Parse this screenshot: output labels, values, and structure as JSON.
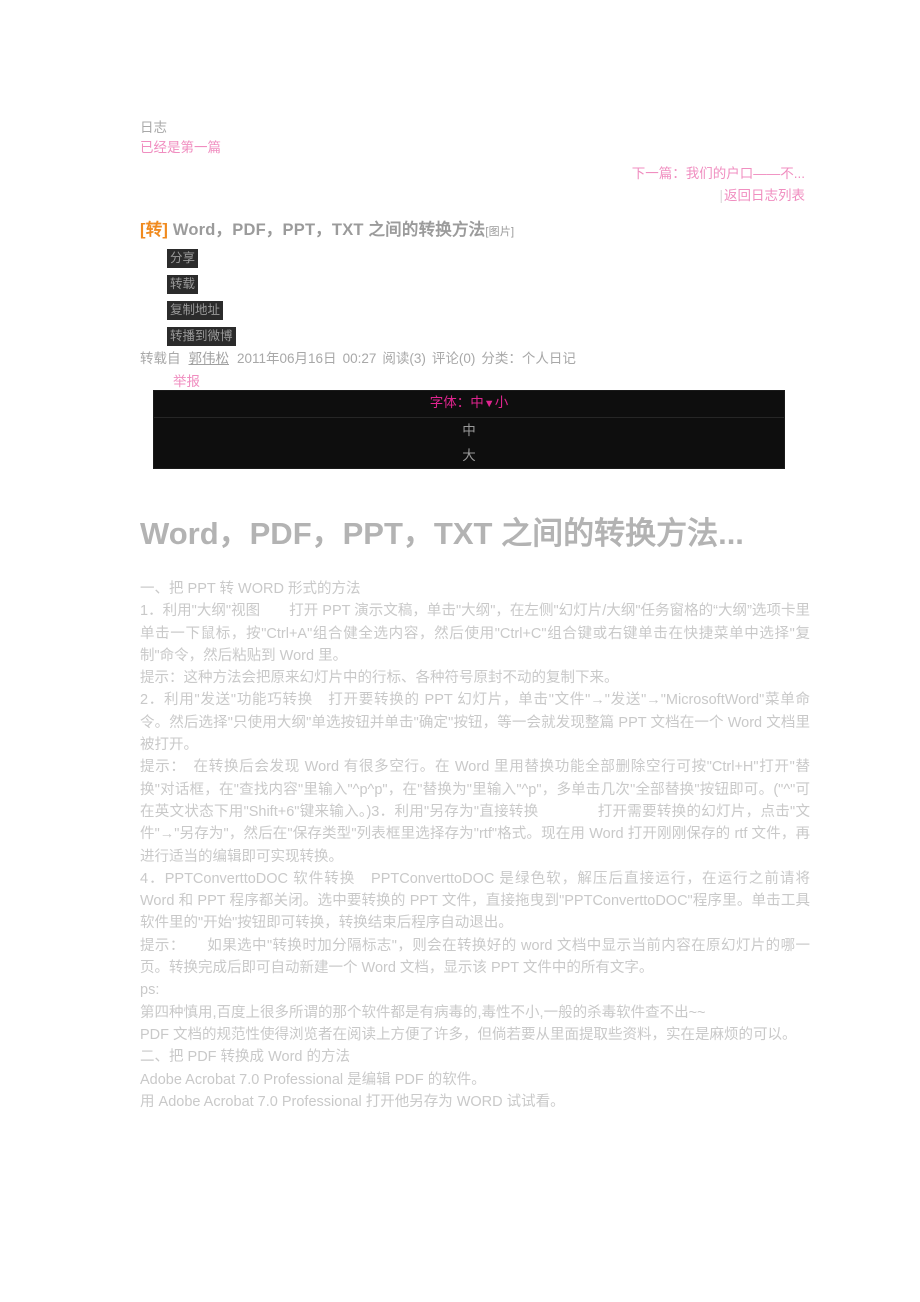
{
  "nav": {
    "section_label": "日志",
    "first_post_label": "已经是第一篇",
    "next_post": "下一篇：我们的户口——不...",
    "back_to_list": "返回日志列表",
    "separator": "|"
  },
  "post": {
    "repost_tag": "[转]",
    "title": "Word，PDF，PPT，TXT 之间的转换方法",
    "picture_tag": "[图片]"
  },
  "share": {
    "buttons": [
      {
        "label": "分享"
      },
      {
        "label": "转载"
      },
      {
        "label": "复制地址"
      },
      {
        "label": "转播到微博"
      }
    ]
  },
  "meta": {
    "source_label": "转载自",
    "author": "郭伟松",
    "date": "2011年06月16日",
    "time": "00:27",
    "reads": "阅读(3)",
    "comments": "评论(0)",
    "category": "分类：个人日记",
    "report_label": "举报"
  },
  "font_selector": {
    "label": "字体：",
    "current": "中",
    "caret": "▼",
    "small": "小",
    "options": [
      "中",
      "大"
    ]
  },
  "article": {
    "heading": "Word，PDF，PPT，TXT 之间的转换方法...",
    "paragraphs": [
      "一、把 PPT 转 WORD 形式的方法",
      "1．利用\"大纲\"视图　　打开 PPT 演示文稿，单击\"大纲\"，在左侧\"幻灯片/大纲\"任务窗格的“大纲”选项卡里单击一下鼠标，按\"Ctrl+A\"组合健全选内容，然后使用\"Ctrl+C\"组合键或右键单击在快捷菜单中选择\"复制\"命令，然后粘贴到 Word 里。",
      "提示：这种方法会把原来幻灯片中的行标、各种符号原封不动的复制下来。",
      "2．利用\"发送\"功能巧转换　打开要转换的 PPT 幻灯片，单击\"文件\"→\"发送\"→\"MicrosoftWord\"菜单命令。然后选择\"只使用大纲\"单选按钮并单击\"确定\"按钮，等一会就发现整篇 PPT 文档在一个 Word 文档里被打开。",
      "提示：　在转换后会发现 Word 有很多空行。在 Word 里用替换功能全部删除空行可按\"Ctrl+H\"打开\"替换\"对话框，在\"查找内容\"里输入\"^p^p\"，在\"替换为\"里输入\"^p\"，多单击几次\"全部替换\"按钮即可。(\"^\"可在英文状态下用\"Shift+6\"键来输入。)3．利用\"另存为\"直接转换　　　　打开需要转换的幻灯片，点击\"文件\"→\"另存为\"，然后在\"保存类型\"列表框里选择存为\"rtf\"格式。现在用 Word 打开刚刚保存的 rtf 文件，再进行适当的编辑即可实现转换。",
      "4．PPTConverttoDOC 软件转换　PPTConverttoDOC 是绿色软，解压后直接运行，在运行之前请将 Word 和 PPT 程序都关闭。选中要转换的 PPT 文件，直接拖曳到\"PPTConverttoDOC\"程序里。单击工具软件里的\"开始\"按钮即可转换，转换结束后程序自动退出。",
      "提示：　　如果选中\"转换时加分隔标志\"，则会在转换好的 word 文档中显示当前内容在原幻灯片的哪一页。转换完成后即可自动新建一个 Word 文档，显示该 PPT 文件中的所有文字。",
      "ps:",
      "第四种慎用,百度上很多所谓的那个软件都是有病毒的,毒性不小,一般的杀毒软件查不出~~",
      "PDF 文档的规范性使得浏览者在阅读上方便了许多，但倘若要从里面提取些资料，实在是麻烦的可以。",
      "二、把 PDF 转换成 Word 的方法",
      "Adobe Acrobat 7.0 Professional  是编辑 PDF 的软件。",
      "用 Adobe Acrobat 7.0 Professional  打开他另存为 WORD 试试看。"
    ]
  },
  "colors": {
    "accent_pink": "#f08ec0",
    "accent_magenta": "#e0248f",
    "repost_orange": "#f08a1e",
    "body_gray": "#c9c9c9",
    "dark_panel": "#0e0e0e",
    "button_dark": "#2b2b2b"
  }
}
